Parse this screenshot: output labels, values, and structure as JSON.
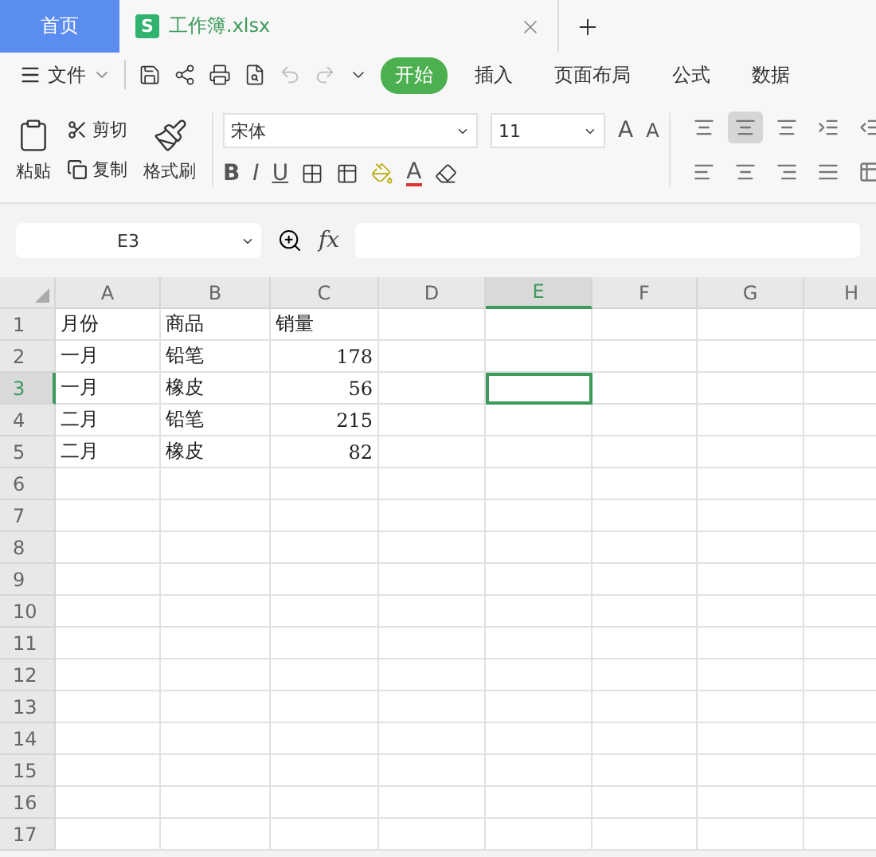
{
  "tabs": [
    {
      "label": "首页",
      "kind": "home",
      "selected": false
    },
    {
      "label": "工作簿.xlsx",
      "kind": "file",
      "badge": "S",
      "selected": true
    }
  ],
  "menu": {
    "label": "文件"
  },
  "ribbon_tabs": [
    {
      "label": "开始",
      "selected": true
    },
    {
      "label": "插入",
      "selected": false
    },
    {
      "label": "页面布局",
      "selected": false
    },
    {
      "label": "公式",
      "selected": false
    },
    {
      "label": "数据",
      "selected": false
    }
  ],
  "clipboard": {
    "paste": "粘贴",
    "cut": "剪切",
    "copy": "复制",
    "format_painter": "格式刷"
  },
  "font": {
    "name": "宋体",
    "size": "11",
    "grow": "A",
    "shrink": "A",
    "bold": "B",
    "italic": "I",
    "underline": "U",
    "color_letter": "A"
  },
  "name_box": {
    "value": "E3"
  },
  "formula_bar": {
    "fx": "fx"
  },
  "columns": [
    {
      "label": "A",
      "selected": false
    },
    {
      "label": "B",
      "selected": false
    },
    {
      "label": "C",
      "selected": false
    },
    {
      "label": "D",
      "selected": false
    },
    {
      "label": "E",
      "selected": true
    },
    {
      "label": "F",
      "selected": false
    },
    {
      "label": "G",
      "selected": false
    },
    {
      "label": "H",
      "selected": false
    }
  ],
  "rows": [
    {
      "label": "1",
      "selected": false,
      "cells": [
        {
          "text": "月份",
          "kind": "text"
        },
        {
          "text": "商品",
          "kind": "text"
        },
        {
          "text": "销量",
          "kind": "text"
        }
      ]
    },
    {
      "label": "2",
      "selected": false,
      "cells": [
        {
          "text": "一月",
          "kind": "text"
        },
        {
          "text": "铅笔",
          "kind": "text"
        },
        {
          "text": "178",
          "kind": "number"
        }
      ]
    },
    {
      "label": "3",
      "selected": true,
      "cells": [
        {
          "text": "一月",
          "kind": "text"
        },
        {
          "text": "橡皮",
          "kind": "text"
        },
        {
          "text": "56",
          "kind": "number"
        }
      ]
    },
    {
      "label": "4",
      "selected": false,
      "cells": [
        {
          "text": "二月",
          "kind": "text"
        },
        {
          "text": "铅笔",
          "kind": "text"
        },
        {
          "text": "215",
          "kind": "number"
        }
      ]
    },
    {
      "label": "5",
      "selected": false,
      "cells": [
        {
          "text": "二月",
          "kind": "text"
        },
        {
          "text": "橡皮",
          "kind": "text"
        },
        {
          "text": "82",
          "kind": "number"
        }
      ]
    },
    {
      "label": "6",
      "selected": false,
      "cells": []
    },
    {
      "label": "7",
      "selected": false,
      "cells": []
    },
    {
      "label": "8",
      "selected": false,
      "cells": []
    },
    {
      "label": "9",
      "selected": false,
      "cells": []
    },
    {
      "label": "10",
      "selected": false,
      "cells": []
    },
    {
      "label": "11",
      "selected": false,
      "cells": []
    },
    {
      "label": "12",
      "selected": false,
      "cells": []
    },
    {
      "label": "13",
      "selected": false,
      "cells": []
    },
    {
      "label": "14",
      "selected": false,
      "cells": []
    },
    {
      "label": "15",
      "selected": false,
      "cells": []
    },
    {
      "label": "16",
      "selected": false,
      "cells": []
    },
    {
      "label": "17",
      "selected": false,
      "cells": []
    }
  ]
}
